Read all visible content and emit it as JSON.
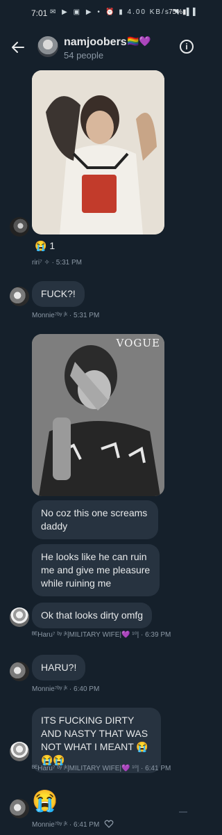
{
  "status_bar": {
    "time": "7:01",
    "left_icons": "✉ ▶ ▣ ▶ •",
    "right_icons": "⏰ ▮ 4.00 KB/s ◥ .▌▌",
    "battery": "75%▮"
  },
  "header": {
    "title": "namjoobers",
    "title_emoji": "🏳️‍🌈💜",
    "subtitle": "54 people",
    "back_icon": "arrow-left",
    "info_icon": "info-circle",
    "info_glyph": "i"
  },
  "messages": [
    {
      "id": "m1",
      "type": "image",
      "sender": "riri",
      "meta": "riri⁷ ✧ · 5:31 PM",
      "reaction_emoji": "😭",
      "reaction_count": "1"
    },
    {
      "id": "m2",
      "type": "text",
      "sender": "Monnie",
      "text": "FUCK?!",
      "meta": "Monnie⁷ᵇʸ ʲᵏ · 5:31 PM"
    },
    {
      "id": "m3",
      "type": "image",
      "sender": "Monnie",
      "image_caption": "VOGUE"
    },
    {
      "id": "m4",
      "type": "text",
      "sender": "Monnie",
      "text": "No coz this one screams daddy"
    },
    {
      "id": "m5",
      "type": "text",
      "sender": "Monnie",
      "text": "He looks like he can ruin me and give me pleasure while ruining me"
    },
    {
      "id": "m6",
      "type": "text",
      "sender": "Haru",
      "text": "Ok that looks dirty omfg",
      "meta": "ᴮᴱHaru⁷ ᵇʸ ʲᵏ|MILITARY WIFE|💜 ¹⁰| · 6:39 PM"
    },
    {
      "id": "m7",
      "type": "text",
      "sender": "Monnie",
      "text": "HARU?!",
      "meta": "Monnie⁷ᵇʸ ʲᵏ · 6:40 PM"
    },
    {
      "id": "m8",
      "type": "text",
      "sender": "Haru",
      "text": "ITS FUCKING DIRTY AND NASTY THAT WAS NOT WHAT I MEANT 😭😭😭",
      "meta": "ᴮᴱHaru⁷ ᵇʸ ʲᵏ|MILITARY WIFE|💜 ¹⁰| · 6:41 PM"
    },
    {
      "id": "m9",
      "type": "emoji",
      "sender": "Monnie",
      "text": "😭",
      "meta": "Monnie⁷ᵇʸ ʲᵏ · 6:41 PM"
    }
  ],
  "colors": {
    "background": "#15202b",
    "bubble": "#273340",
    "meta_text": "#8b98a5",
    "primary_text": "#e7e9ea"
  }
}
